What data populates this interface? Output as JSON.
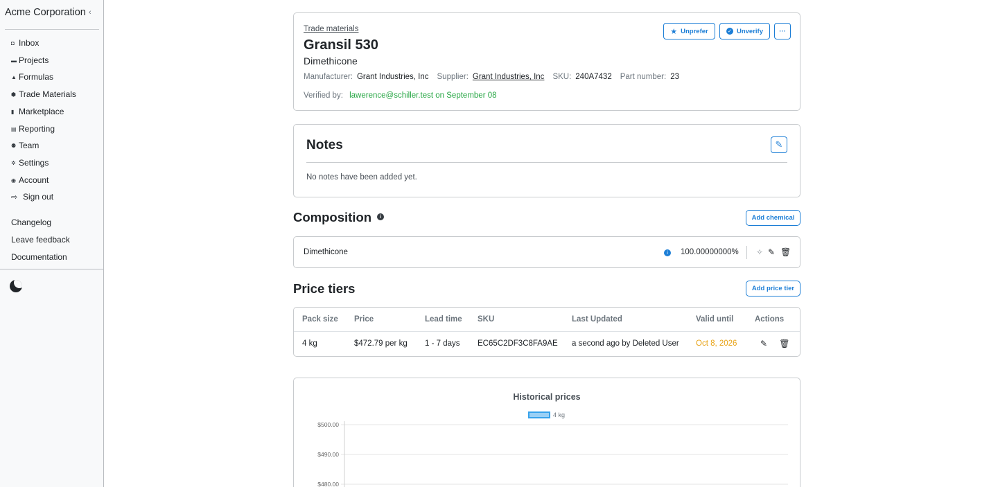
{
  "sidebar": {
    "brand": "Acme Corporation",
    "collapse_icon": "chevron-left",
    "nav": [
      {
        "label": "Inbox",
        "icon": "inbox-icon",
        "glyph": "◘"
      },
      {
        "label": "Projects",
        "icon": "folder-icon",
        "glyph": "▬"
      },
      {
        "label": "Formulas",
        "icon": "flask-icon",
        "glyph": "▲"
      },
      {
        "label": "Trade Materials",
        "icon": "cube-icon",
        "glyph": "⬢"
      },
      {
        "label": "Marketplace",
        "icon": "building-icon",
        "glyph": "▮"
      },
      {
        "label": "Reporting",
        "icon": "table-icon",
        "glyph": "▤"
      },
      {
        "label": "Team",
        "icon": "users-icon",
        "glyph": "⚉"
      },
      {
        "label": "Settings",
        "icon": "gear-icon",
        "glyph": "✲"
      },
      {
        "label": "Account",
        "icon": "user-circle-icon",
        "glyph": "◉"
      },
      {
        "label": "Sign out",
        "icon": "sign-out-icon",
        "glyph": "⇨"
      }
    ],
    "links": [
      "Changelog",
      "Leave feedback",
      "Documentation"
    ],
    "theme_icon": "moon-icon"
  },
  "material": {
    "breadcrumb": "Trade materials",
    "name": "Gransil 530",
    "chemical": "Dimethicone",
    "manufacturer_label": "Manufacturer:",
    "manufacturer": "Grant Industries, Inc",
    "supplier_label": "Supplier:",
    "supplier": "Grant Industries, Inc",
    "sku_label": "SKU:",
    "sku": "240A7432",
    "part_label": "Part number:",
    "part": "23",
    "verified_label": "Verified by:",
    "verified_value": "lawerence@schiller.test on September 08",
    "buttons": {
      "unprefer": "Unprefer",
      "unverify": "Unverify",
      "more": "···"
    }
  },
  "notes": {
    "title": "Notes",
    "empty": "No notes have been added yet.",
    "edit_icon": "pencil-icon"
  },
  "composition": {
    "title": "Composition",
    "add_label": "Add chemical",
    "rows": [
      {
        "name": "Dimethicone",
        "percent": "100.00000000%"
      }
    ]
  },
  "price_tiers": {
    "title": "Price tiers",
    "add_label": "Add price tier",
    "columns": [
      "Pack size",
      "Price",
      "Lead time",
      "SKU",
      "Last Updated",
      "Valid until",
      "Actions"
    ],
    "rows": [
      {
        "pack_size": "4 kg",
        "price": "$472.79 per kg",
        "lead_time": "1 - 7 days",
        "sku": "EC65C2DF3C8FA9AE",
        "last_updated": "a second ago by Deleted User",
        "valid_until": "Oct 8, 2026"
      }
    ]
  },
  "colors": {
    "accent": "#1c7ed6",
    "verified": "#28a745",
    "warning": "#e8a317",
    "series": "#36a2eb"
  },
  "chart_data": {
    "type": "line",
    "title": "Historical prices",
    "series": [
      {
        "name": "4 kg",
        "values": []
      }
    ],
    "y_ticks": [
      "$500.00",
      "$490.00",
      "$480.00"
    ],
    "ylim": [
      480,
      500
    ],
    "legend": "top-center",
    "grid": true
  }
}
